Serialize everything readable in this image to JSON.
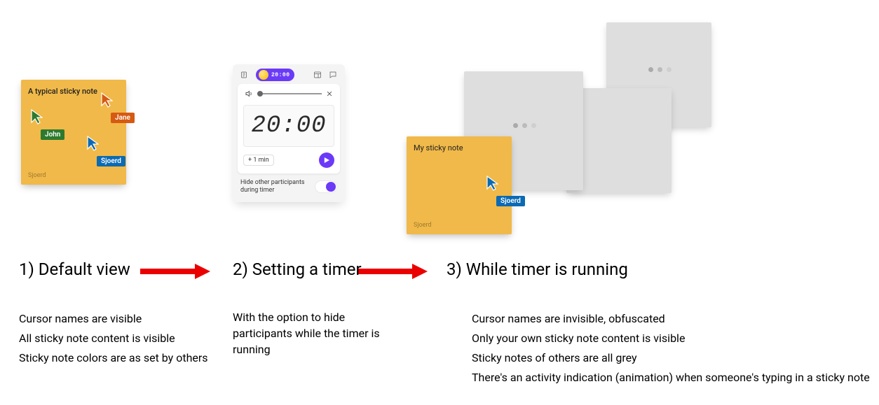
{
  "step1": {
    "heading": "1) Default view",
    "sticky_title": "A typical sticky note",
    "sticky_author": "Sjoerd",
    "cursors": {
      "john": {
        "label": "John",
        "color": "#2d7a2e"
      },
      "jane": {
        "label": "Jane",
        "color": "#d65a12"
      },
      "sjoerd": {
        "label": "Sjoerd",
        "color": "#0b6ab3"
      }
    },
    "captions": [
      "Cursor names are visible",
      "All sticky note content is visible",
      "Sticky note colors are as set by others"
    ]
  },
  "step2": {
    "heading": "2) Setting a timer",
    "pill_time": "20:00",
    "digital_time": "20:00",
    "increment_label": "+ 1 min",
    "hide_label": "Hide other participants during timer",
    "toggle_on": true,
    "caption": "With the option to hide participants while the timer is running"
  },
  "step3": {
    "heading": "3) While timer is running",
    "my_note_title": "My sticky note",
    "my_note_author": "Sjoerd",
    "my_cursor_label": "Sjoerd",
    "my_cursor_color": "#0b6ab3",
    "captions": [
      "Cursor names are invisible, obfuscated",
      "Only your own sticky note content is visible",
      "Sticky notes of others are all grey",
      "There's an activity indication (animation) when someone's typing in a sticky note"
    ]
  },
  "arrow_color": "#ea0000"
}
